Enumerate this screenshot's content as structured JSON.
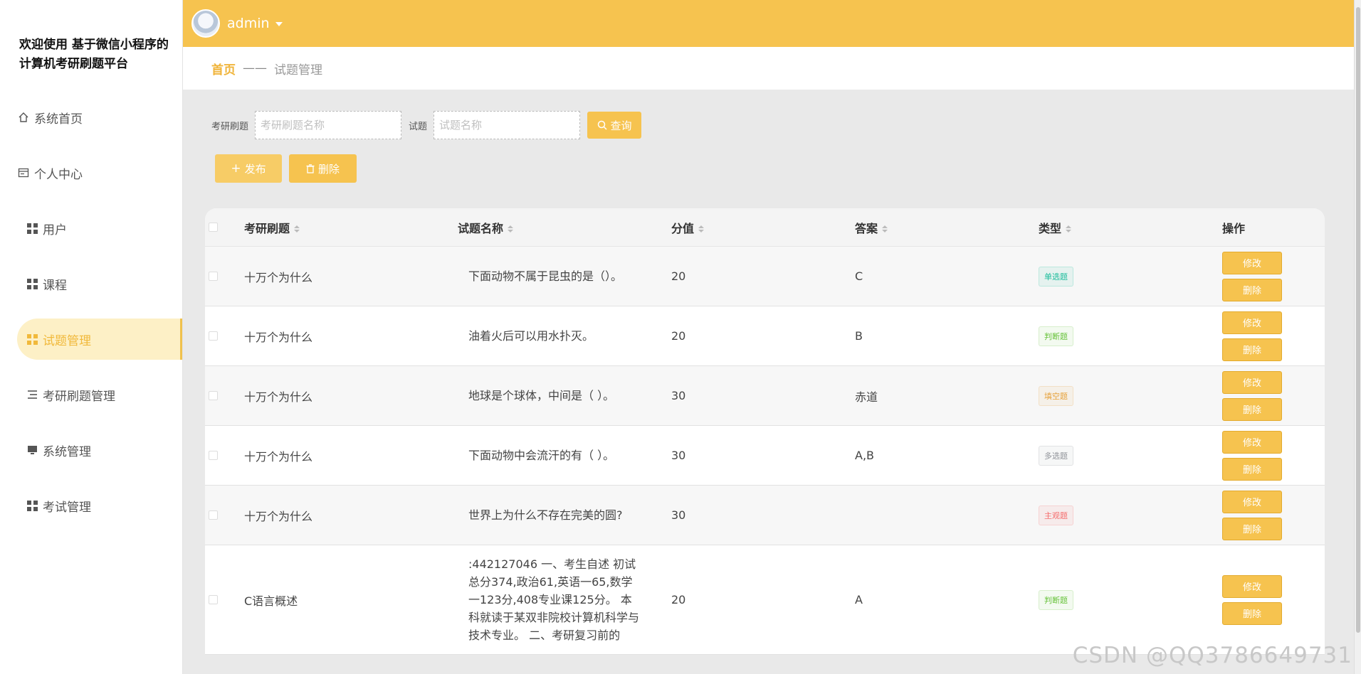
{
  "sidebar": {
    "brand": "欢迎使用 基于微信小程序的计算机考研刷题平台",
    "items": [
      {
        "label": "系统首页",
        "icon": "home-icon"
      },
      {
        "label": "个人中心",
        "icon": "card-icon"
      },
      {
        "label": "用户",
        "icon": "grid-icon"
      },
      {
        "label": "课程",
        "icon": "grid-icon"
      },
      {
        "label": "试题管理",
        "icon": "grid-icon",
        "active": true
      },
      {
        "label": "考研刷题管理",
        "icon": "list-icon"
      },
      {
        "label": "系统管理",
        "icon": "monitor-icon"
      },
      {
        "label": "考试管理",
        "icon": "grid-icon"
      }
    ]
  },
  "header": {
    "username": "admin"
  },
  "breadcrumb": {
    "home": "首页",
    "sep": "——",
    "current": "试题管理"
  },
  "search": {
    "label1": "考研刷题",
    "placeholder1": "考研刷题名称",
    "label2": "试题",
    "placeholder2": "试题名称",
    "query": "查询"
  },
  "actions": {
    "add": "发布",
    "delete": "删除"
  },
  "table": {
    "headers": [
      "考研刷题",
      "试题名称",
      "分值",
      "答案",
      "类型",
      "操作"
    ],
    "rows": [
      {
        "exam": "十万个为什么",
        "name": "下面动物不属于昆虫的是（）。",
        "score": "20",
        "answer": "C",
        "type": "单选题",
        "edit": "修改",
        "del": "删除"
      },
      {
        "exam": "十万个为什么",
        "name": "油着火后可以用水扑灭。",
        "score": "20",
        "answer": "B",
        "type": "判断题",
        "edit": "修改",
        "del": "删除"
      },
      {
        "exam": "十万个为什么",
        "name": "地球是个球体，中间是（ ）。",
        "score": "30",
        "answer": "赤道",
        "type": "填空题",
        "edit": "修改",
        "del": "删除"
      },
      {
        "exam": "十万个为什么",
        "name": "下面动物中会流汗的有（ ）。",
        "score": "30",
        "answer": "A,B",
        "type": "多选题",
        "edit": "修改",
        "del": "删除"
      },
      {
        "exam": "十万个为什么",
        "name": "世界上为什么不存在完美的圆?",
        "score": "30",
        "answer": "",
        "type": "主观题",
        "edit": "修改",
        "del": "删除"
      },
      {
        "exam": "C语言概述",
        "name": ":442127046 一、考生自述 初试总分374,政治61,英语一65,数学一123分,408专业课125分。 本科就读于某双非院校计算机科学与技术专业。 二、考研复习前的",
        "score": "20",
        "answer": "A",
        "type": "判断题",
        "edit": "修改",
        "del": "删除"
      }
    ]
  },
  "colors": {
    "accent": "#f6c34f",
    "tag_single": "#1bbc9b",
    "tag_judge": "#67c23a",
    "tag_fill": "#e6a23c",
    "tag_multi": "#909399",
    "tag_subjective": "#f56c6c"
  },
  "watermark": "CSDN @QQ3786649731"
}
